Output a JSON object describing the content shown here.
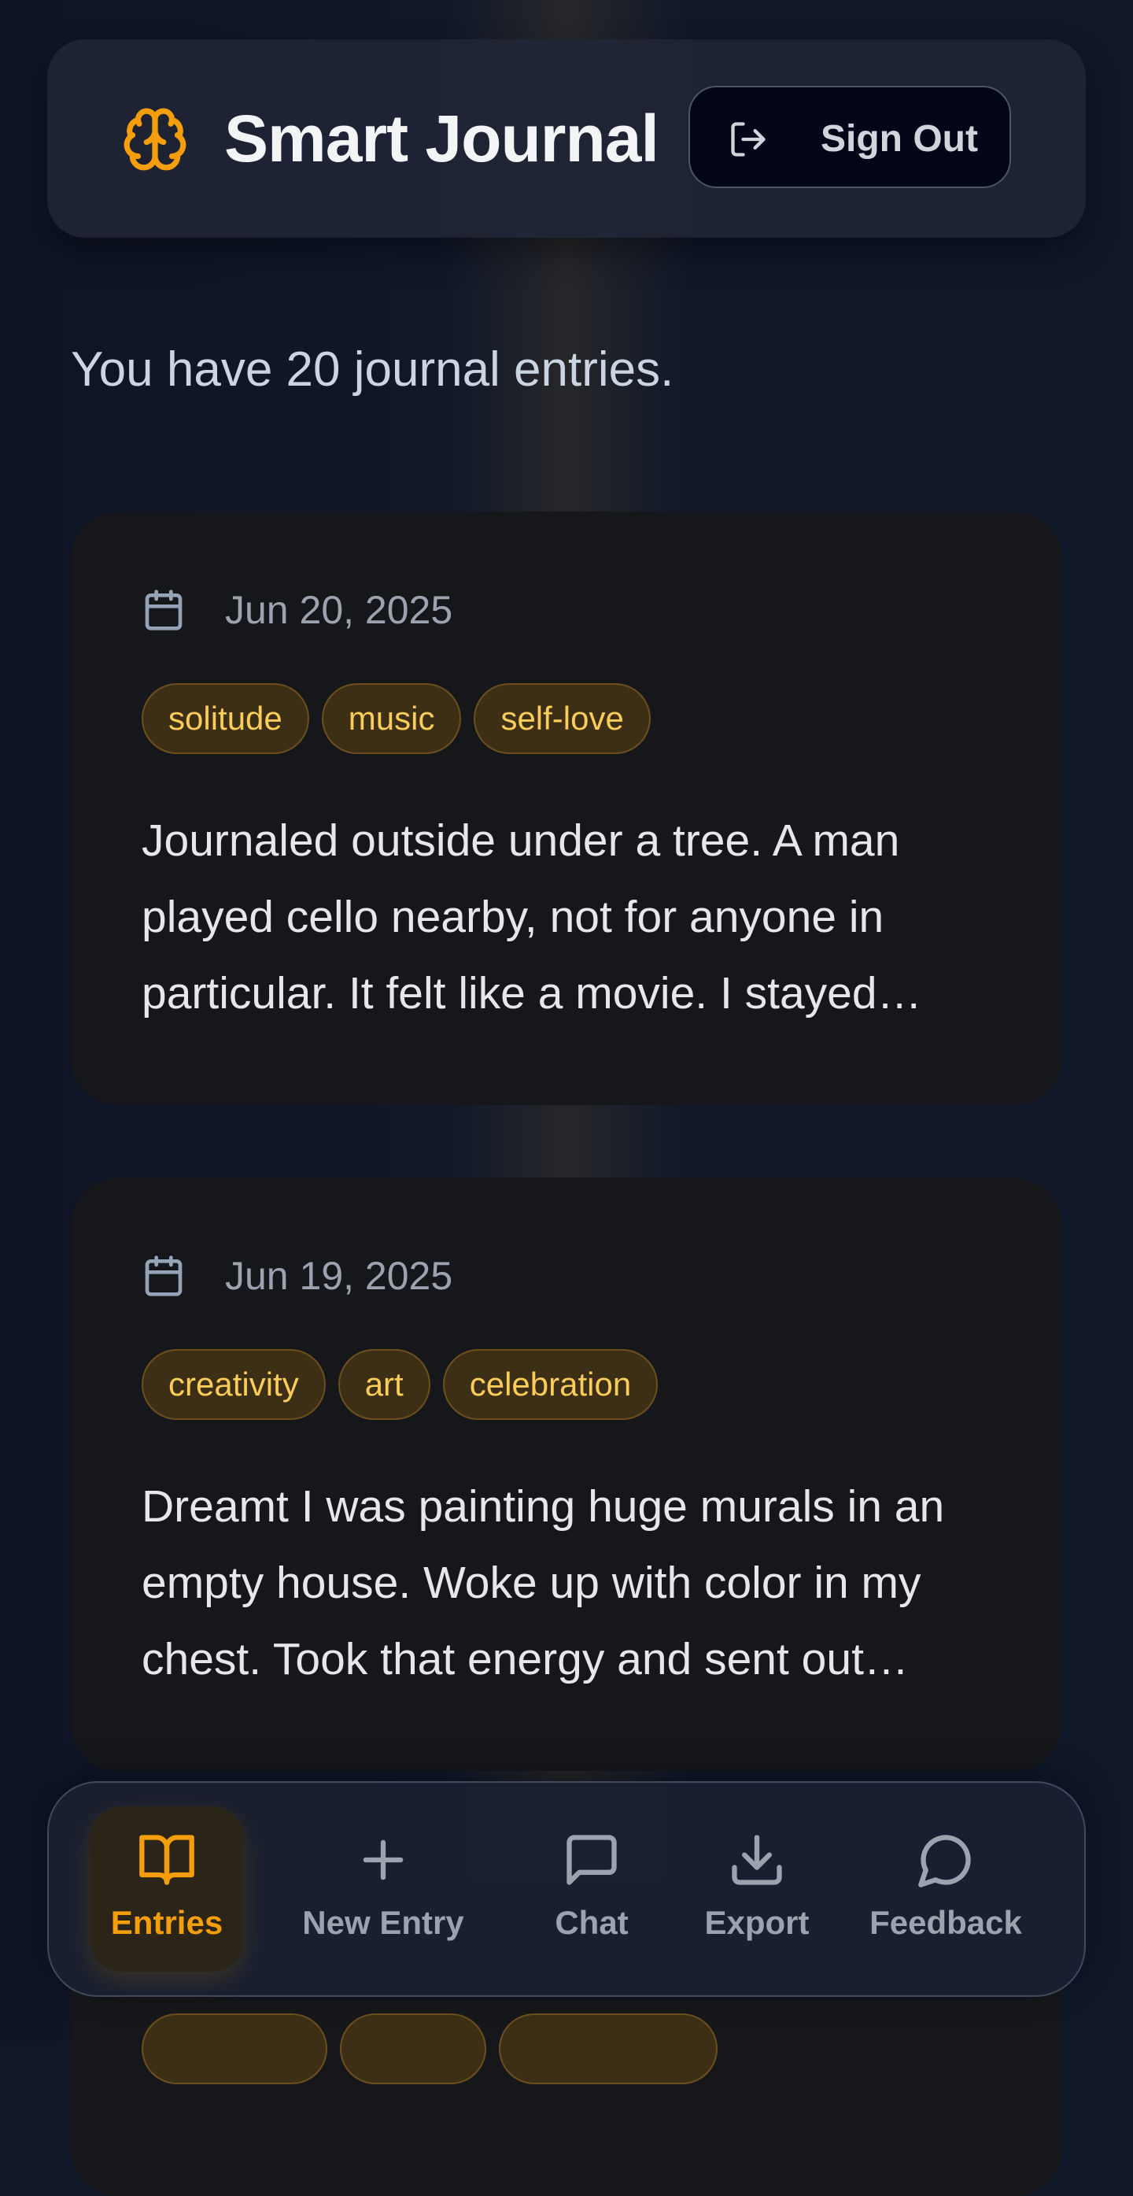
{
  "colors": {
    "accent": "#f59e0b",
    "background": "#0f1729",
    "card": "#16171b",
    "tag_text": "#facc5a",
    "tag_bg": "#3d2f16"
  },
  "header": {
    "title": "Smart Journal",
    "brand_icon": "brain-icon",
    "signout_label": "Sign Out",
    "signout_icon": "log-out-icon"
  },
  "summary": {
    "count_text": "You have 20 journal entries."
  },
  "entries": [
    {
      "date": "Jun 20, 2025",
      "tags": [
        "solitude",
        "music",
        "self-love"
      ],
      "excerpt": "Journaled outside under a tree. A man played cello nearby, not for anyone in particular. It felt like a movie. I stayed…"
    },
    {
      "date": "Jun 19, 2025",
      "tags": [
        "creativity",
        "art",
        "celebration"
      ],
      "excerpt": "Dreamt I was painting huge murals in an empty house. Woke up with color in my chest. Took that energy and sent out…"
    }
  ],
  "nav": {
    "items": [
      {
        "label": "Entries",
        "icon": "book-open-icon",
        "active": true
      },
      {
        "label": "New Entry",
        "icon": "plus-icon",
        "active": false
      },
      {
        "label": "Chat",
        "icon": "message-square-icon",
        "active": false
      },
      {
        "label": "Export",
        "icon": "download-icon",
        "active": false
      },
      {
        "label": "Feedback",
        "icon": "message-circle-icon",
        "active": false
      }
    ]
  }
}
